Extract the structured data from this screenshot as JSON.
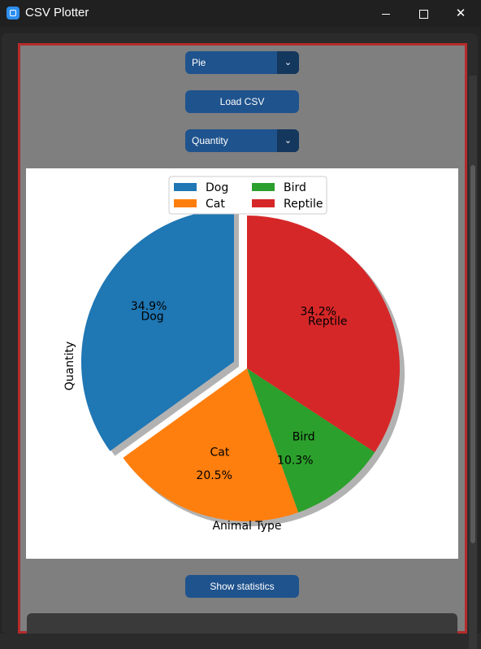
{
  "window": {
    "title": "CSV Plotter",
    "minimize_icon": "minimize-icon",
    "maximize_icon": "maximize-icon",
    "close_icon": "close-icon"
  },
  "controls": {
    "chart_type_select": {
      "value": "Pie"
    },
    "load_csv_button": "Load CSV",
    "column_select": {
      "value": "Quantity"
    },
    "show_statistics_button": "Show statistics"
  },
  "chart_data": {
    "type": "pie",
    "categories": [
      "Dog",
      "Cat",
      "Bird",
      "Reptile"
    ],
    "values": [
      34.9,
      20.5,
      10.3,
      34.2
    ],
    "percent_labels": [
      "34.9%",
      "20.5%",
      "10.3%",
      "34.2%"
    ],
    "colors": [
      "#1f77b4",
      "#ff7f0e",
      "#2ca02c",
      "#d62728"
    ],
    "exploded": [
      "Dog"
    ],
    "shadow": true,
    "ylabel": "Quantity",
    "xlabel": "Animal Type",
    "legend": "top-center"
  }
}
